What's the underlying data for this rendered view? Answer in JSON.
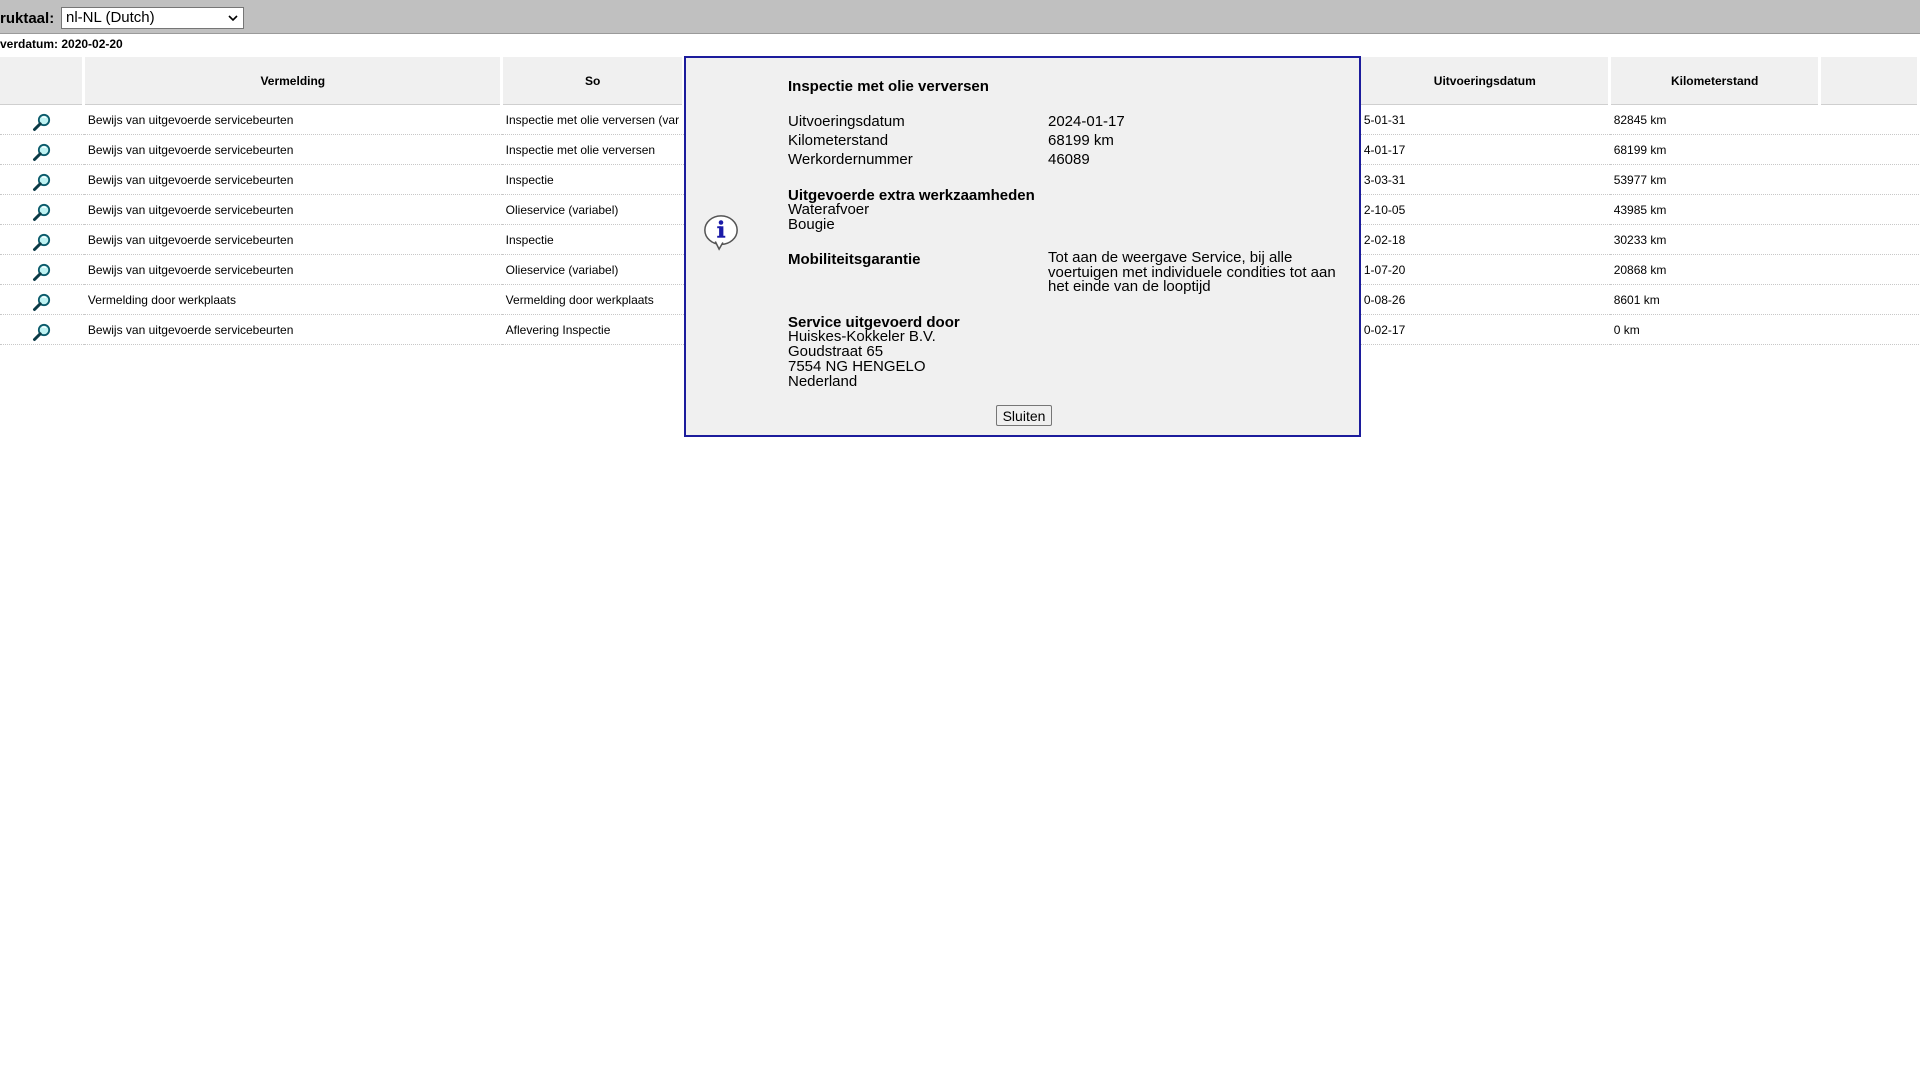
{
  "toolbar": {
    "language_label": "ruktaal:",
    "language_value": "nl-NL (Dutch)"
  },
  "delivery_date_line": "verdatum: 2020-02-20",
  "table": {
    "headers": {
      "col0": "",
      "vermelding": "Vermelding",
      "service": "So",
      "gap": "",
      "uitvoeringsdatum": "Uitvoeringsdatum",
      "kilometerstand": "Kilometerstand",
      "last": ""
    },
    "rows": [
      {
        "vermelding": "Bewijs van uitgevoerde servicebeurten",
        "service": "Inspectie met olie verversen (var",
        "datum": "5-01-31",
        "km": "82845 km"
      },
      {
        "vermelding": "Bewijs van uitgevoerde servicebeurten",
        "service": "Inspectie met olie verversen",
        "datum": "4-01-17",
        "km": "68199 km"
      },
      {
        "vermelding": "Bewijs van uitgevoerde servicebeurten",
        "service": "Inspectie",
        "datum": "3-03-31",
        "km": "53977 km"
      },
      {
        "vermelding": "Bewijs van uitgevoerde servicebeurten",
        "service": "Olieservice (variabel)",
        "datum": "2-10-05",
        "km": "43985 km"
      },
      {
        "vermelding": "Bewijs van uitgevoerde servicebeurten",
        "service": "Inspectie",
        "datum": "2-02-18",
        "km": "30233 km"
      },
      {
        "vermelding": "Bewijs van uitgevoerde servicebeurten",
        "service": "Olieservice (variabel)",
        "datum": "1-07-20",
        "km": "20868 km"
      },
      {
        "vermelding": "Vermelding door werkplaats",
        "service": "Vermelding door werkplaats",
        "datum": "0-08-26",
        "km": "8601 km"
      },
      {
        "vermelding": "Bewijs van uitgevoerde servicebeurten",
        "service": "Aflevering Inspectie",
        "datum": "0-02-17",
        "km": "0 km"
      }
    ]
  },
  "dialog": {
    "title": "Inspectie met olie verversen",
    "uitvoeringsdatum_label": "Uitvoeringsdatum",
    "uitvoeringsdatum_value": "2024-01-17",
    "kilometerstand_label": "Kilometerstand",
    "kilometerstand_value": "68199 km",
    "werkorder_label": "Werkordernummer",
    "werkorder_value": "46089",
    "extra_heading": "Uitgevoerde extra werkzaamheden",
    "extra_items": [
      "Waterafvoer",
      "Bougie"
    ],
    "mobility_heading": "Mobiliteitsgarantie",
    "mobility_text": "Tot aan de weergave Service, bij alle voertuigen met individuele condities tot aan het einde van de looptijd",
    "dealer_heading": "Service uitgevoerd door",
    "dealer_lines": [
      "Huiskes-Kokkeler B.V.",
      "Goudstraat 65",
      "7554 NG HENGELO",
      "Nederland"
    ],
    "close_label": "Sluiten"
  },
  "colors": {
    "topbar": "#c0c0c0",
    "header_bg": "#f0f0f0",
    "dialog_border": "#1c1c9c",
    "dialog_bg": "#f0f0f0"
  },
  "icons": {
    "row_action": "magnifier-icon",
    "dialog": "info-icon",
    "select": "chevron-down-icon"
  }
}
